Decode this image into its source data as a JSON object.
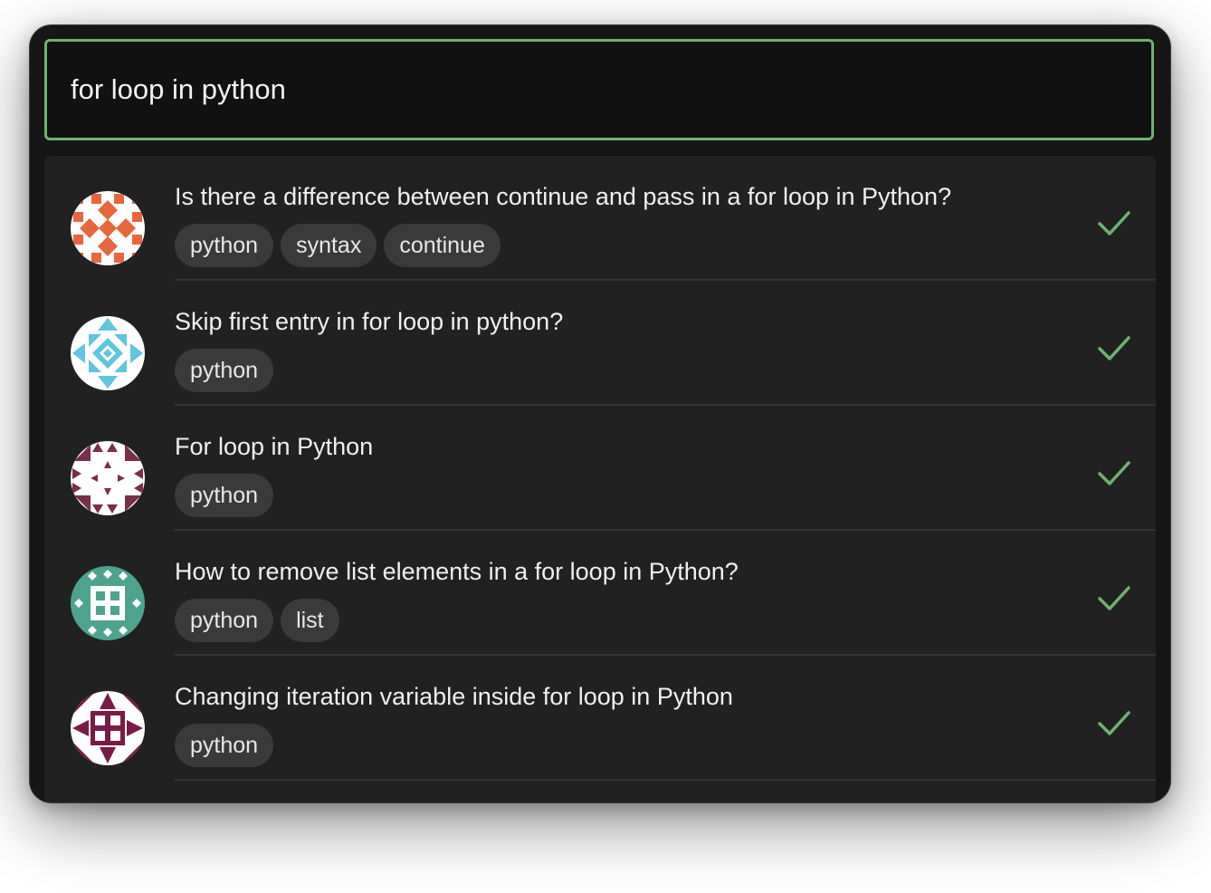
{
  "search": {
    "value": "for loop in python"
  },
  "accent_color": "#6db36e",
  "results": [
    {
      "title": "Is there a difference between continue and pass in a for loop in Python?",
      "tags": [
        "python",
        "syntax",
        "continue"
      ],
      "avatar_color": "#e8663d",
      "accepted_icon": "check-icon"
    },
    {
      "title": "Skip first entry in for loop in python?",
      "tags": [
        "python"
      ],
      "avatar_color": "#5fc6dd",
      "accepted_icon": "check-icon"
    },
    {
      "title": "For loop in Python",
      "tags": [
        "python"
      ],
      "avatar_color": "#7a2e4a",
      "accepted_icon": "check-icon"
    },
    {
      "title": "How to remove list elements in a for loop in Python?",
      "tags": [
        "python",
        "list"
      ],
      "avatar_color": "#4ea38e",
      "accepted_icon": "check-icon"
    },
    {
      "title": "Changing iteration variable inside for loop in Python",
      "tags": [
        "python"
      ],
      "avatar_color": "#7b1a46",
      "accepted_icon": "check-icon"
    }
  ]
}
